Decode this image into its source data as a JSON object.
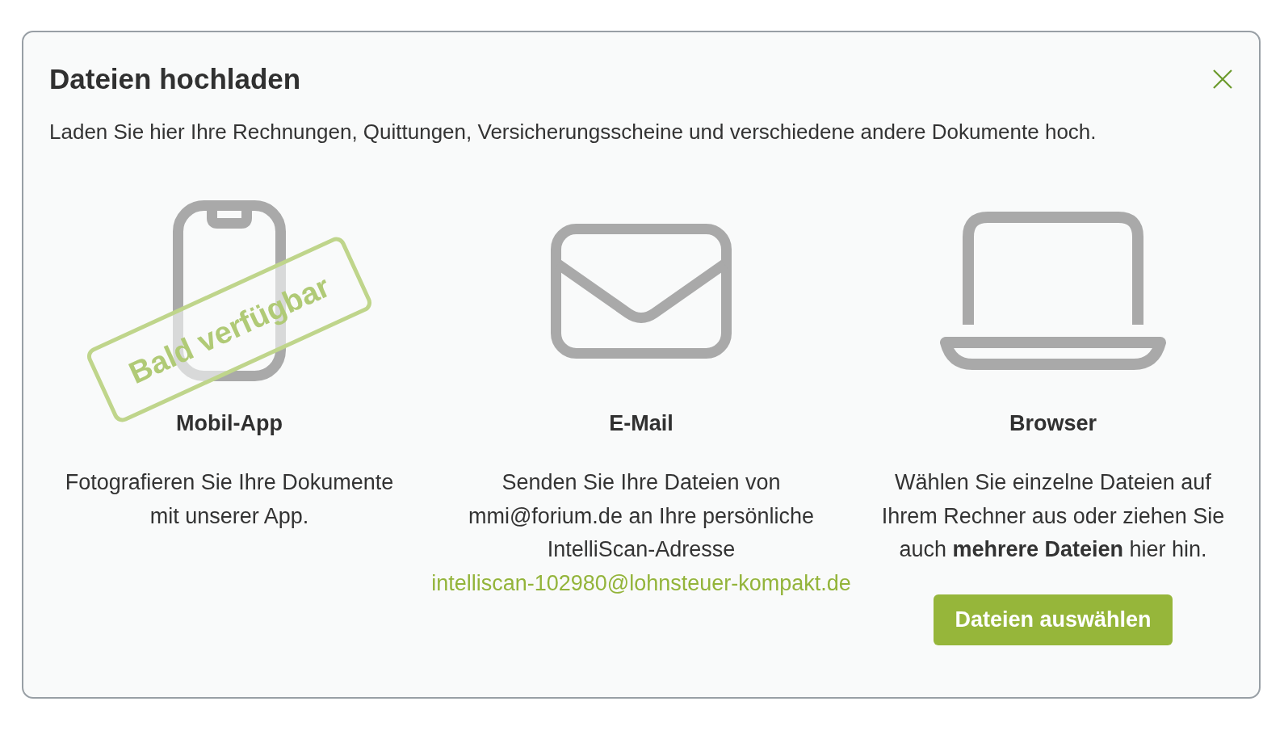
{
  "dialog": {
    "title": "Dateien hochladen",
    "description": "Laden Sie hier Ihre Rechnungen, Quittungen, Versicherungsscheine und verschiedene andere Dokumente hoch."
  },
  "options": [
    {
      "kind": "mobile",
      "title": "Mobil-App",
      "text": "Fotografieren Sie Ihre Dokumente mit unserer App.",
      "badge": "Bald verfügbar"
    },
    {
      "kind": "email",
      "title": "E-Mail",
      "text": "Senden Sie Ihre Dateien von mmi@forium.de an Ihre persönliche IntelliScan-Adresse",
      "link": "intelliscan-102980@lohnsteuer-kompakt.de"
    },
    {
      "kind": "browser",
      "title": "Browser",
      "text": "Wählen Sie einzelne Dateien auf Ihrem Rechner aus oder ziehen Sie auch **mehrere Dateien** hier hin.",
      "button": "Dateien auswählen"
    }
  ]
}
